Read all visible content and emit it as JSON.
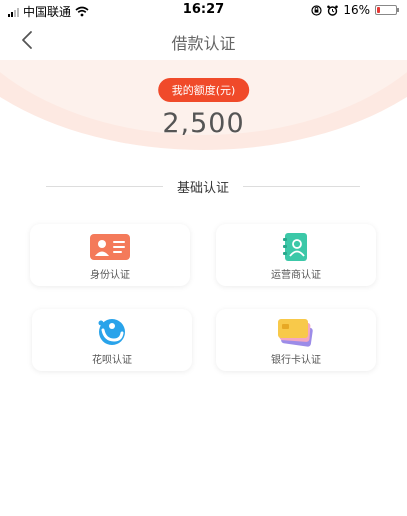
{
  "status_bar": {
    "carrier": "中国联通",
    "time": "16:27",
    "battery_percent": "16%",
    "battery_level": 0.16
  },
  "nav": {
    "title": "借款认证",
    "back_icon": "chevron-left-icon"
  },
  "credit_limit": {
    "label": "我的额度(元)",
    "amount": "2,500",
    "accent_color": "#f04a2a"
  },
  "section": {
    "title": "基础认证"
  },
  "verifications": [
    {
      "label": "身份认证",
      "icon": "id-card-icon"
    },
    {
      "label": "运营商认证",
      "icon": "contact-book-icon"
    },
    {
      "label": "花呗认证",
      "icon": "huabei-icon"
    },
    {
      "label": "银行卡认证",
      "icon": "bank-card-icon"
    }
  ]
}
